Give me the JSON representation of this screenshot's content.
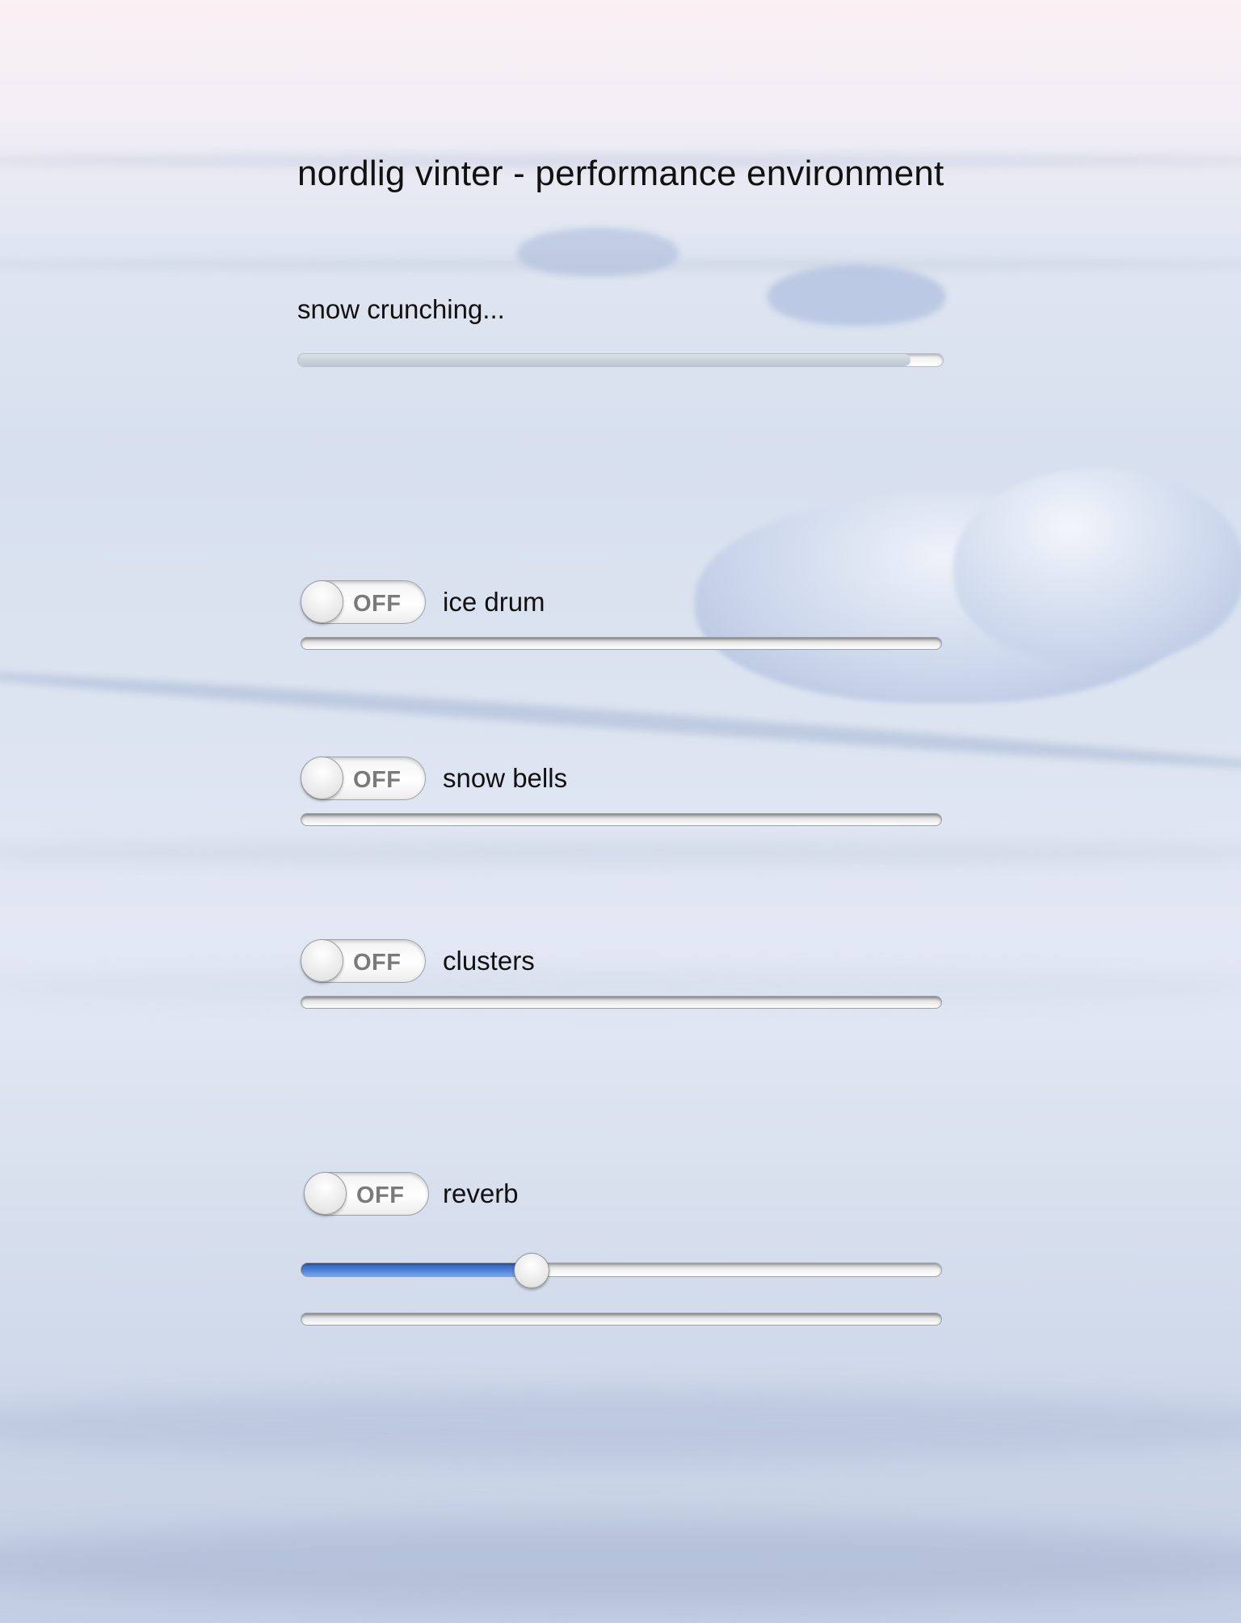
{
  "header": {
    "title": "nordlig vinter - performance environment"
  },
  "status": {
    "label": "snow crunching...",
    "progress": 0.95
  },
  "channels": [
    {
      "toggle_text": "OFF",
      "label": "ice drum",
      "enabled": false
    },
    {
      "toggle_text": "OFF",
      "label": "snow bells",
      "enabled": false
    },
    {
      "toggle_text": "OFF",
      "label": "clusters",
      "enabled": false
    },
    {
      "toggle_text": "OFF",
      "label": "reverb",
      "enabled": false
    }
  ],
  "reverb": {
    "slider_value": 0.36
  },
  "theme": {
    "slider_fill": "#4a7fd6",
    "text": "#111111"
  }
}
